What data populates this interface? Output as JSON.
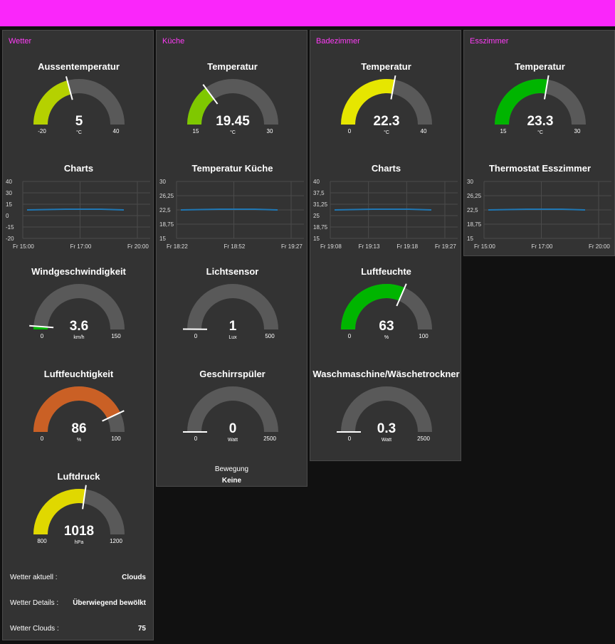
{
  "groups": {
    "wetter": {
      "title": "Wetter",
      "aussen": {
        "title": "Aussentemperatur",
        "value": "5",
        "unit": "°C",
        "min": "-20",
        "max": "40",
        "fraction": 0.417,
        "color": "#b5d100"
      },
      "chart": {
        "title": "Charts",
        "y_ticks": [
          "40",
          "30",
          "15",
          "0",
          "-15",
          "-20"
        ],
        "x_ticks": [
          "Fr 15:00",
          "Fr 17:00",
          "Fr 20:00"
        ]
      },
      "wind": {
        "title": "Windgeschwindigkeit",
        "value": "3.6",
        "unit": "km/h",
        "min": "0",
        "max": "150",
        "fraction": 0.024,
        "color": "#00b500"
      },
      "feucht": {
        "title": "Luftfeuchtigkeit",
        "value": "86",
        "unit": "%",
        "min": "0",
        "max": "100",
        "fraction": 0.86,
        "color": "#ca6025"
      },
      "druck": {
        "title": "Luftdruck",
        "value": "1018",
        "unit": "hPa",
        "min": "800",
        "max": "1200",
        "fraction": 0.545,
        "color": "#e0d800"
      },
      "rows": [
        {
          "label": "Wetter aktuell :",
          "value": "Clouds"
        },
        {
          "label": "Wetter Details :",
          "value": "Überwiegend bewölkt"
        },
        {
          "label": "Wetter Clouds :",
          "value": "75"
        }
      ]
    },
    "kueche": {
      "title": "Küche",
      "temp": {
        "title": "Temperatur",
        "value": "19.45",
        "unit": "°C",
        "min": "15",
        "max": "30",
        "fraction": 0.297,
        "color": "#7fc800"
      },
      "chart": {
        "title": "Temperatur Küche",
        "y_ticks": [
          "30",
          "26,25",
          "22,5",
          "18,75",
          "15"
        ],
        "x_ticks": [
          "Fr 18:22",
          "Fr 18:52",
          "Fr 19:27"
        ]
      },
      "licht": {
        "title": "Lichtsensor",
        "value": "1",
        "unit": "Lux",
        "min": "0",
        "max": "500",
        "fraction": 0.002,
        "color": "#00b500"
      },
      "spueler": {
        "title": "Geschirrspüler",
        "value": "0",
        "unit": "Watt",
        "min": "0",
        "max": "2500",
        "fraction": 0.0,
        "color": "#00b500"
      },
      "bewegung": {
        "label": "Bewegung",
        "value": "Keine"
      }
    },
    "bad": {
      "title": "Badezimmer",
      "temp": {
        "title": "Temperatur",
        "value": "22.3",
        "unit": "°C",
        "min": "0",
        "max": "40",
        "fraction": 0.557,
        "color": "#e6e600"
      },
      "chart": {
        "title": "Charts",
        "y_ticks": [
          "40",
          "37,5",
          "31,25",
          "25",
          "18,75",
          "15"
        ],
        "x_ticks": [
          "Fr 19:08",
          "Fr 19:13",
          "Fr 19:18",
          "Fr 19:27"
        ]
      },
      "feuchte": {
        "title": "Luftfeuchte",
        "value": "63",
        "unit": "%",
        "min": "0",
        "max": "100",
        "fraction": 0.63,
        "color": "#00b500"
      },
      "wasch": {
        "title": "Waschmaschine/Wäschetrockner",
        "value": "0.3",
        "unit": "Watt",
        "min": "0",
        "max": "2500",
        "fraction": 0.0,
        "color": "#00b500"
      }
    },
    "ess": {
      "title": "Esszimmer",
      "temp": {
        "title": "Temperatur",
        "value": "23.3",
        "unit": "°C",
        "min": "15",
        "max": "30",
        "fraction": 0.553,
        "color": "#00b500"
      },
      "chart": {
        "title": "Thermostat Esszimmer",
        "y_ticks": [
          "30",
          "26,25",
          "22,5",
          "18,75",
          "15"
        ],
        "x_ticks": [
          "Fr 15:00",
          "Fr 17:00",
          "Fr 20:00"
        ]
      }
    }
  },
  "colors": {
    "track": "#595959",
    "needle": "#ffffff",
    "line": "#1f77b4",
    "accent": "#fa26fa"
  }
}
